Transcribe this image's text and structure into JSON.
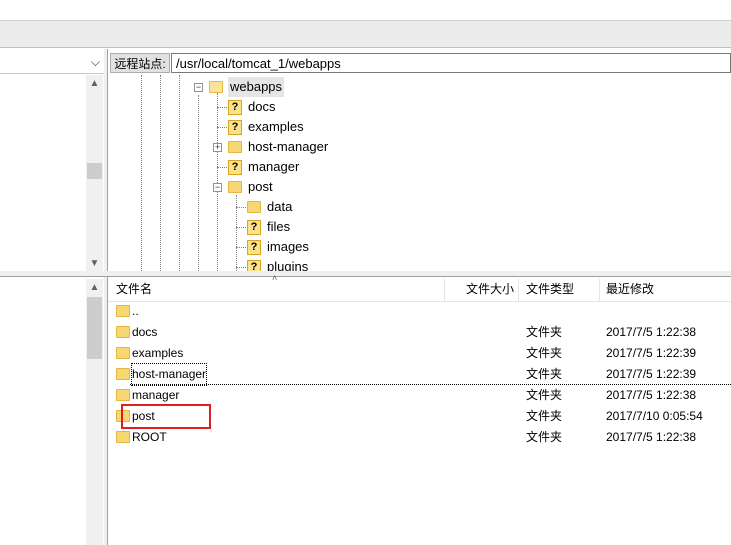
{
  "local": {
    "combo_value": "",
    "combo_icon": "chevron-down-icon"
  },
  "remote": {
    "site_label": "远程站点:",
    "path": "/usr/local/tomcat_1/webapps",
    "tree": [
      {
        "label": "webapps",
        "icon": "folder-open-icon",
        "expander": "−"
      },
      {
        "label": "docs",
        "icon": "question-folder-icon"
      },
      {
        "label": "examples",
        "icon": "question-folder-icon"
      },
      {
        "label": "host-manager",
        "icon": "folder-icon",
        "expander": "+"
      },
      {
        "label": "manager",
        "icon": "question-folder-icon"
      },
      {
        "label": "post",
        "icon": "folder-icon",
        "expander": "−"
      },
      {
        "label": "data",
        "icon": "folder-icon"
      },
      {
        "label": "files",
        "icon": "question-folder-icon"
      },
      {
        "label": "images",
        "icon": "question-folder-icon"
      },
      {
        "label": "plugins",
        "icon": "question-folder-icon"
      }
    ]
  },
  "filelist": {
    "columns": {
      "name": "文件名",
      "size": "文件大小",
      "type": "文件类型",
      "modified": "最近修改"
    },
    "rows": [
      {
        "name": "..",
        "size": "",
        "type": "",
        "modified": ""
      },
      {
        "name": "docs",
        "size": "",
        "type": "文件夹",
        "modified": "2017/7/5 1:22:38"
      },
      {
        "name": "examples",
        "size": "",
        "type": "文件夹",
        "modified": "2017/7/5 1:22:39"
      },
      {
        "name": "host-manager",
        "size": "",
        "type": "文件夹",
        "modified": "2017/7/5 1:22:39"
      },
      {
        "name": "manager",
        "size": "",
        "type": "文件夹",
        "modified": "2017/7/5 1:22:38"
      },
      {
        "name": "post",
        "size": "",
        "type": "文件夹",
        "modified": "2017/7/10 0:05:54"
      },
      {
        "name": "ROOT",
        "size": "",
        "type": "文件夹",
        "modified": "2017/7/5 1:22:38"
      }
    ]
  },
  "annotation_color": "#e02020"
}
